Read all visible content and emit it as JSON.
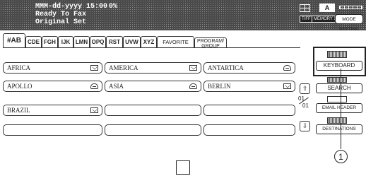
{
  "status": {
    "date": "MMM-dd-yyyy",
    "time": "15:00",
    "percent": "0%",
    "line2": "Ready To Fax",
    "line3": "Original Set",
    "paper_size": "A",
    "tiff": "TIFF",
    "memory_xmt": "MEMORY XMT",
    "mode_setting": "MODE SETTING"
  },
  "tabs": [
    {
      "label": "#AB"
    },
    {
      "label": "CDE"
    },
    {
      "label": "FGH"
    },
    {
      "label": "IJK"
    },
    {
      "label": "LMN"
    },
    {
      "label": "OPQ"
    },
    {
      "label": "RST"
    },
    {
      "label": "UVW"
    },
    {
      "label": "XYZ"
    },
    {
      "label": "FAVORITE"
    },
    {
      "label": "PROGRAM/ GROUP"
    }
  ],
  "entries": [
    {
      "label": "AFRICA",
      "icon": "envelope-icon"
    },
    {
      "label": "AMERICA",
      "icon": "envelope-icon"
    },
    {
      "label": "ANTARTICA",
      "icon": "phone-icon"
    },
    {
      "label": "APOLLO",
      "icon": "phone-icon"
    },
    {
      "label": "ASIA",
      "icon": "phone-icon"
    },
    {
      "label": "BERLIN",
      "icon": "envelope-icon"
    },
    {
      "label": "BRAZIL",
      "icon": "envelope-icon"
    },
    {
      "label": "",
      "icon": ""
    },
    {
      "label": "",
      "icon": ""
    },
    {
      "label": "",
      "icon": ""
    },
    {
      "label": "",
      "icon": ""
    },
    {
      "label": "",
      "icon": ""
    }
  ],
  "pager": {
    "current": "01",
    "total": "01"
  },
  "side": {
    "keyboard": "KEYBOARD",
    "search": "SEARCH",
    "email_header": "EMAIL HEADER",
    "destinations": "DESTINATIONS"
  },
  "callout": "1"
}
